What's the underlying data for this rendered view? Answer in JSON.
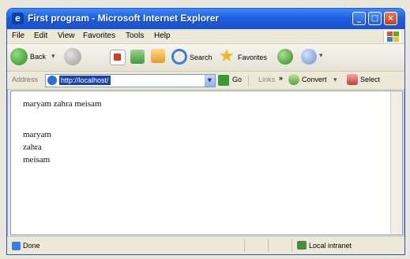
{
  "window": {
    "title": "First program - Microsoft Internet Explorer",
    "controls": {
      "minimize": "_",
      "maximize": "□",
      "close": "×"
    }
  },
  "menubar": {
    "items": [
      {
        "label": "File"
      },
      {
        "label": "Edit"
      },
      {
        "label": "View"
      },
      {
        "label": "Favorites"
      },
      {
        "label": "Tools"
      },
      {
        "label": "Help"
      }
    ]
  },
  "toolbar": {
    "back_label": "Back",
    "search_label": "Search",
    "favorites_label": "Favorites"
  },
  "addressbar": {
    "label": "Address",
    "value": "http://localhost/",
    "go_label": "Go",
    "links_label": "Links",
    "more": "»",
    "convert_label": "Convert",
    "select_label": "Select"
  },
  "page": {
    "lines": [
      "maryam zahra meisam",
      "maryam",
      "zahra",
      "meisam"
    ]
  },
  "statusbar": {
    "status_text": "Done",
    "zone_text": "Local intranet"
  },
  "colors": {
    "title_bar": "#1f5fe0",
    "close_button": "#c63e1a",
    "window_frame": "#ece9d8"
  }
}
